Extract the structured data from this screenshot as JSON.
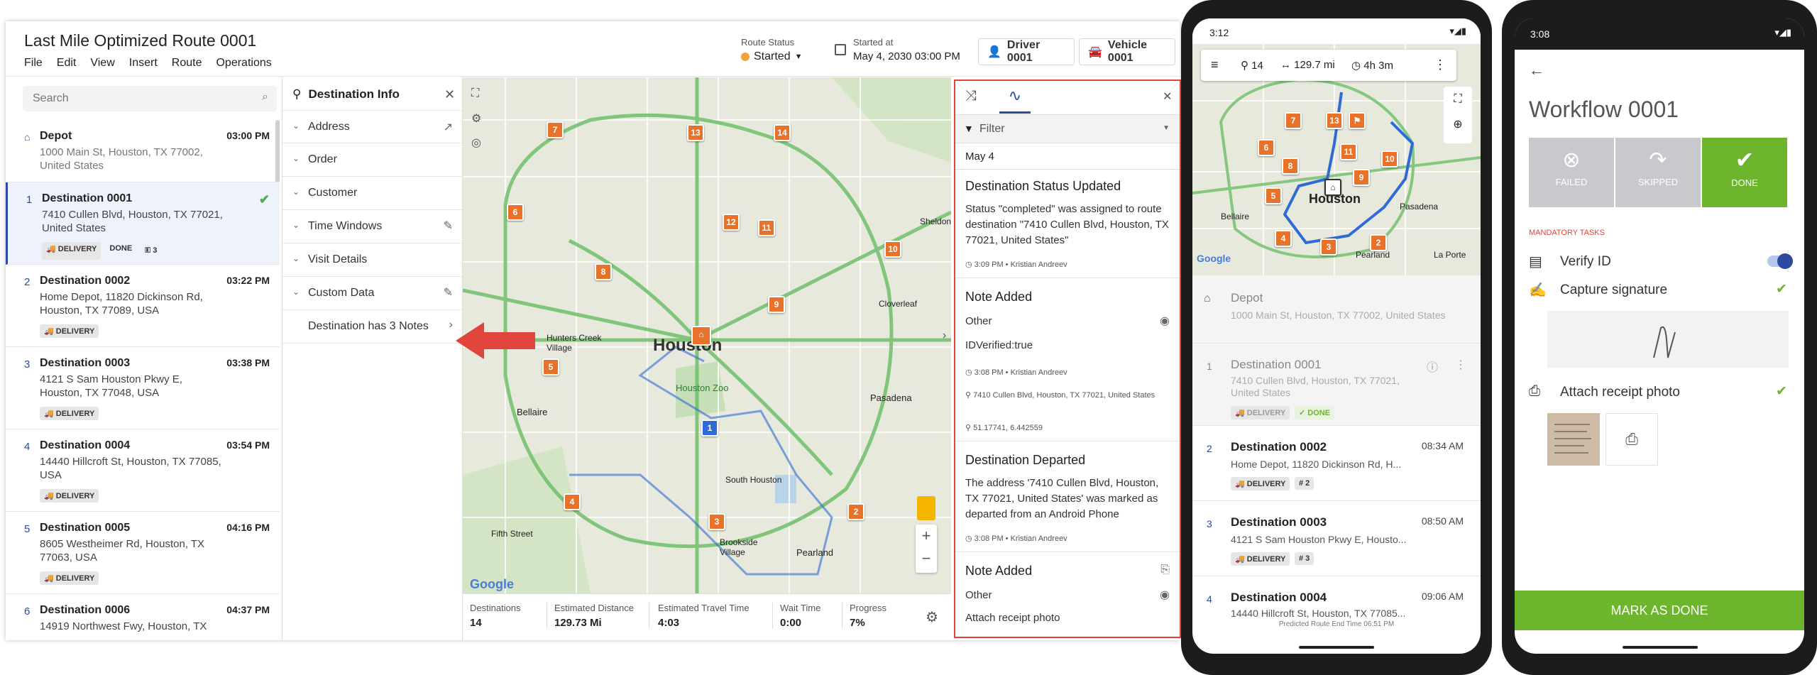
{
  "app": {
    "title": "Last Mile Optimized Route 0001",
    "menu": [
      "File",
      "Edit",
      "View",
      "Insert",
      "Route",
      "Operations"
    ],
    "route_status_caption": "Route Status",
    "route_status_value": "Started",
    "started_caption": "Started at",
    "started_value": "May 4, 2030 03:00 PM",
    "driver": "Driver 0001",
    "vehicle": "Vehicle 0001"
  },
  "list": {
    "search_placeholder": "Search",
    "stops": [
      {
        "num": "",
        "name": "Depot",
        "time": "03:00 PM",
        "address": "1000 Main St, Houston, TX 77002, United States",
        "badges": []
      },
      {
        "num": "1",
        "name": "Destination 0001",
        "time": "",
        "address": "7410 Cullen Blvd, Houston, TX 77021, United States",
        "badges": [
          "DELIVERY",
          "DONE",
          "3"
        ]
      },
      {
        "num": "2",
        "name": "Destination 0002",
        "time": "03:22 PM",
        "address": "Home Depot, 11820 Dickinson Rd, Houston, TX 77089, USA",
        "badges": [
          "DELIVERY"
        ]
      },
      {
        "num": "3",
        "name": "Destination 0003",
        "time": "03:38 PM",
        "address": "4121 S Sam Houston Pkwy E, Houston, TX 77048, USA",
        "badges": [
          "DELIVERY"
        ]
      },
      {
        "num": "4",
        "name": "Destination 0004",
        "time": "03:54 PM",
        "address": "14440 Hillcroft St, Houston, TX 77085, USA",
        "badges": [
          "DELIVERY"
        ]
      },
      {
        "num": "5",
        "name": "Destination 0005",
        "time": "04:16 PM",
        "address": "8605 Westheimer Rd, Houston, TX 77063, USA",
        "badges": [
          "DELIVERY"
        ]
      },
      {
        "num": "6",
        "name": "Destination 0006",
        "time": "04:37 PM",
        "address": "14919 Northwest Fwy, Houston, TX",
        "badges": []
      }
    ]
  },
  "dest_info": {
    "title": "Destination Info",
    "rows": [
      "Address",
      "Order",
      "Customer",
      "Time Windows",
      "Visit Details",
      "Custom Data"
    ],
    "notes_link": "Destination has 3 Notes"
  },
  "map": {
    "city_label": "Houston",
    "zoo_label": "Houston Zoo",
    "places": [
      "Sheldon",
      "Cloverleaf",
      "Hunters Creek Village",
      "Bellaire",
      "Pasadena",
      "South Houston",
      "Fifth Street",
      "Brookside Village",
      "Pearland"
    ],
    "markers": [
      "7",
      "13",
      "14",
      "6",
      "12",
      "11",
      "10",
      "8",
      "9",
      "5",
      "4",
      "3",
      "2",
      "1"
    ],
    "google": "Google"
  },
  "stats": [
    {
      "label": "Destinations",
      "value": "14"
    },
    {
      "label": "Estimated Distance",
      "value": "129.73 Mi"
    },
    {
      "label": "Estimated Travel Time",
      "value": "4:03"
    },
    {
      "label": "Wait Time",
      "value": "0:00"
    },
    {
      "label": "Progress",
      "value": "7%"
    }
  ],
  "feed": {
    "filter": "Filter",
    "date": "May 4",
    "events": [
      {
        "title": "Destination Status Updated",
        "body": "Status \"completed\" was assigned to route destination \"7410 Cullen Blvd, Houston, TX 77021, United States\"",
        "meta": "3:09 PM • Kristian Andreev"
      },
      {
        "title": "Note Added",
        "type": "Other",
        "body": "IDVerified:true",
        "meta": "3:08 PM • Kristian Andreev",
        "addr": "7410 Cullen Blvd, Houston, TX 77021, United States",
        "coords": "51.17741, 6.442559"
      },
      {
        "title": "Destination Departed",
        "body": "The address '7410 Cullen Blvd, Houston, TX 77021, United States' was marked as departed from an Android Phone",
        "meta": "3:08 PM • Kristian Andreev"
      },
      {
        "title": "Note Added",
        "type": "Other",
        "body": "Attach receipt photo"
      }
    ]
  },
  "phone1": {
    "clock": "3:12",
    "summary_stops": "14",
    "summary_distance": "129.7 mi",
    "summary_time": "4h 3m",
    "map_city": "Houston",
    "map_places": [
      "Bellaire",
      "Pasadena",
      "La Porte",
      "Pearland"
    ],
    "google": "Google",
    "stops": [
      {
        "num": "",
        "name": "Depot",
        "time": "",
        "address": "1000 Main St, Houston, TX 77002, United States",
        "tags": []
      },
      {
        "num": "1",
        "name": "Destination 0001",
        "time": "",
        "address": "7410 Cullen Blvd, Houston, TX 77021, United States",
        "tags": [
          "DELIVERY",
          "✓ DONE"
        ]
      },
      {
        "num": "2",
        "name": "Destination 0002",
        "time": "08:34 AM",
        "address": "Home Depot, 11820 Dickinson Rd, H...",
        "tags": [
          "DELIVERY",
          "# 2"
        ]
      },
      {
        "num": "3",
        "name": "Destination 0003",
        "time": "08:50 AM",
        "address": "4121 S Sam Houston Pkwy E, Housto...",
        "tags": [
          "DELIVERY",
          "# 3"
        ]
      },
      {
        "num": "4",
        "name": "Destination 0004",
        "time": "09:06 AM",
        "address": "14440 Hillcroft St, Houston, TX 77085...",
        "tags": []
      }
    ],
    "footer": "Predicted Route End Time 06:51 PM"
  },
  "phone2": {
    "clock": "3:08",
    "title": "Workflow 0001",
    "buttons": [
      "FAILED",
      "SKIPPED",
      "DONE"
    ],
    "section": "MANDATORY TASKS",
    "tasks": [
      "Verify ID",
      "Capture signature",
      "Attach receipt photo"
    ],
    "cta": "MARK AS DONE"
  },
  "colors": {
    "accent": "#2b4aa0",
    "orange": "#e8722a",
    "green": "#6cb52d",
    "red": "#e0443a",
    "route": "#2f6bd6"
  }
}
